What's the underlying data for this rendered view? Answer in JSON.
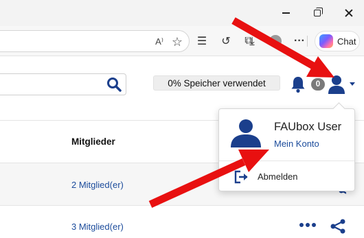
{
  "browser": {
    "chat_label": "Chat",
    "read_aloud_glyph": "A⁾",
    "favorite_glyph": "☆",
    "favorites_glyph": "☰",
    "history_glyph": "↺",
    "extensions_glyph": "⧉",
    "download_glyph": "⤓",
    "more_glyph": "···"
  },
  "header": {
    "storage_label": "0% Speicher verwendet",
    "notification_count": "0"
  },
  "table": {
    "column_members": "Mitglieder",
    "rows": [
      {
        "members": "2 Mitglied(er)"
      },
      {
        "members": "3 Mitglied(er)"
      }
    ]
  },
  "user_menu": {
    "user_name": "FAUbox User",
    "account_link": "Mein Konto",
    "logout_label": "Abmelden"
  },
  "colors": {
    "brand_blue": "#1b3f8c",
    "link_blue": "#1b4b9b",
    "arrow_red": "#e81010"
  }
}
